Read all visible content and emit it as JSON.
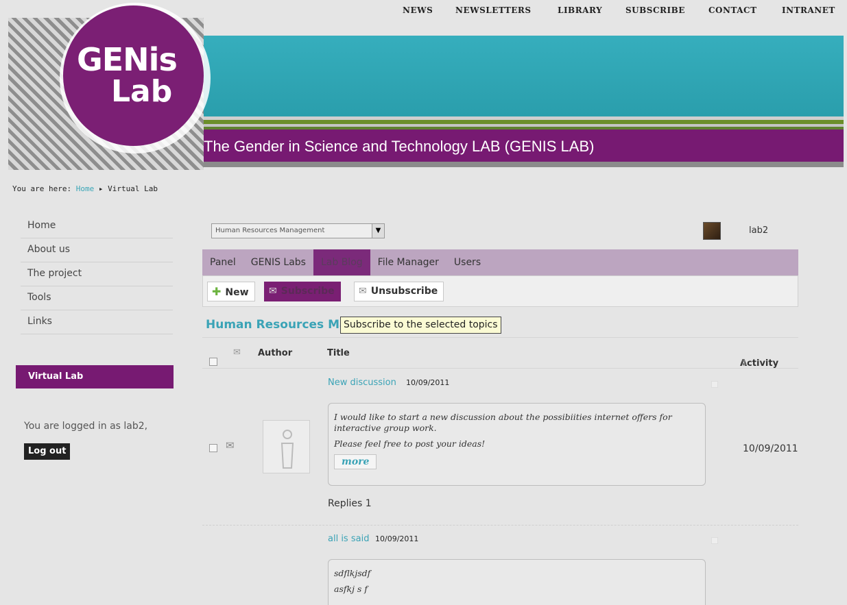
{
  "topnav": [
    "NEWS",
    "NEWSLETTERS",
    "LIBRARY",
    "SUBSCRIBE",
    "CONTACT",
    "INTRANET"
  ],
  "header": {
    "logo_top": "GENis",
    "logo_bottom": "Lab",
    "tagline": "The Gender in Science and Technology LAB (GENIS LAB)"
  },
  "breadcrumb": {
    "prefix": "You are here:",
    "home": "Home",
    "separator": "▸",
    "current": "Virtual Lab"
  },
  "sidebar": {
    "items": [
      "Home",
      "About us",
      "The project",
      "Tools",
      "Links"
    ],
    "section": "Virtual Lab",
    "logged_in": "You are logged in as lab2,",
    "logout": "Log out"
  },
  "main": {
    "group_select": "Human Resources Management",
    "username": "lab2",
    "tabs": [
      "Panel",
      "GENIS Labs",
      "Lab Blog",
      "File Manager",
      "Users"
    ],
    "active_tab": "Lab Blog",
    "toolbar": {
      "new": "New",
      "subscribe": "Subscribe",
      "unsubscribe": "Unsubscribe"
    },
    "tooltip": "Subscribe to the selected topics",
    "forum_title": "Human Resources Ma",
    "columns": {
      "author": "Author",
      "title": "Title",
      "activity": "Activity"
    },
    "topics": [
      {
        "title": "New discussion",
        "date": "10/09/2011",
        "body": [
          "I would like to start a new discussion about the possibiities internet offers for interactive group work.",
          "Please feel free to post your ideas!"
        ],
        "more": "more",
        "replies": "Replies 1",
        "activity": "10/09/2011"
      },
      {
        "title": "all is said",
        "date": "10/09/2011",
        "body": [
          "sdflkjsdf",
          "asfkj s f"
        ]
      }
    ]
  },
  "colors": {
    "purple": "#771a72",
    "cyan": "#2fa8b7",
    "link": "#3aa3b6",
    "tab_bg": "#bca5c0"
  },
  "icons": [
    "plus-icon",
    "envelope-icon",
    "envelope-open-icon",
    "sort-down-icon",
    "person-placeholder-icon",
    "dropdown-arrow-icon"
  ]
}
